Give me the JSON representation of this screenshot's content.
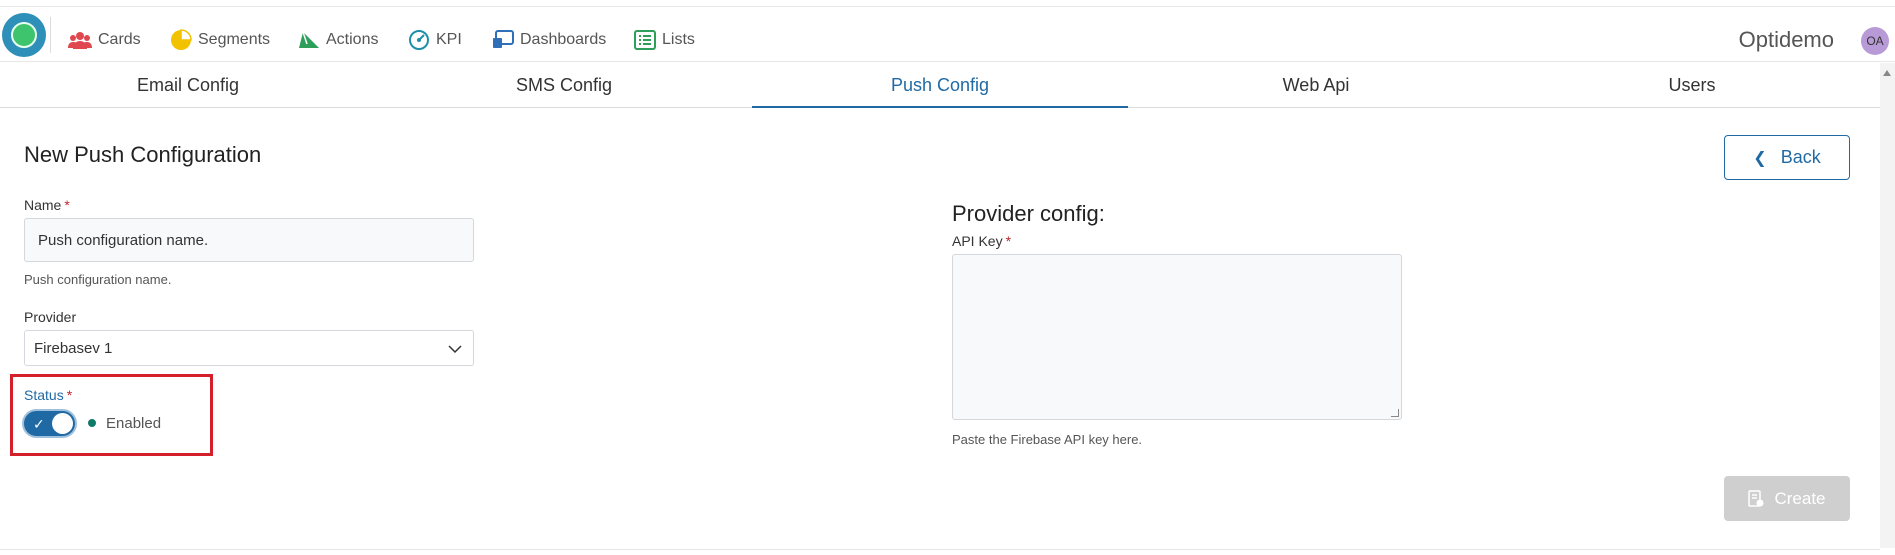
{
  "nav": {
    "items": [
      {
        "label": "Cards",
        "icon": "users-icon",
        "color": "#e0484f"
      },
      {
        "label": "Segments",
        "icon": "pie-chart-icon",
        "color": "#f2c200"
      },
      {
        "label": "Actions",
        "icon": "send-icon",
        "color": "#2e9e5b"
      },
      {
        "label": "KPI",
        "icon": "gauge-icon",
        "color": "#1f8fa8"
      },
      {
        "label": "Dashboards",
        "icon": "dashboard-icon",
        "color": "#2e6fb8"
      },
      {
        "label": "Lists",
        "icon": "list-icon",
        "color": "#2e9e5b"
      }
    ],
    "brand": "Optidemo",
    "avatar_initials": "OA"
  },
  "tabs": [
    {
      "label": "Email Config",
      "active": false
    },
    {
      "label": "SMS Config",
      "active": false
    },
    {
      "label": "Push Config",
      "active": true
    },
    {
      "label": "Web Api",
      "active": false
    },
    {
      "label": "Users",
      "active": false
    }
  ],
  "form": {
    "title": "New Push Configuration",
    "back_label": "Back",
    "name": {
      "label": "Name",
      "required_mark": "*",
      "value": "Push configuration name.",
      "hint": "Push configuration name."
    },
    "provider": {
      "label": "Provider",
      "value": "Firebasev 1"
    },
    "status": {
      "label": "Status",
      "required_mark": "*",
      "enabled": true,
      "state_text": "Enabled"
    },
    "provider_config": {
      "title": "Provider config:",
      "api_key": {
        "label": "API Key",
        "required_mark": "*",
        "value": "",
        "hint": "Paste the Firebase API key here."
      }
    },
    "create_label": "Create"
  },
  "colors": {
    "accent": "#1f6aa5",
    "required": "#c0262d",
    "highlight": "#d3202a",
    "status_dot": "#0f7a67"
  }
}
